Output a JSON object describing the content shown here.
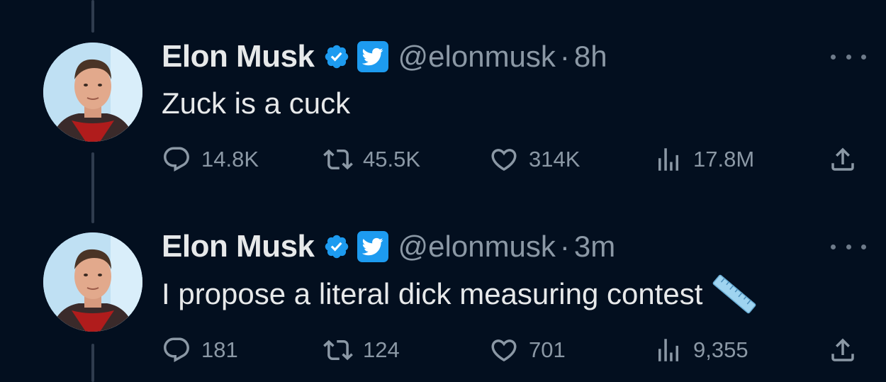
{
  "tweets": [
    {
      "name": "Elon Musk",
      "handle": "@elonmusk",
      "separator": "·",
      "time": "8h",
      "text": "Zuck is a cuck",
      "reply_count": "14.8K",
      "retweet_count": "45.5K",
      "like_count": "314K",
      "view_count": "17.8M"
    },
    {
      "name": "Elon Musk",
      "handle": "@elonmusk",
      "separator": "·",
      "time": "3m",
      "text": "I propose a literal dick measuring contest",
      "reply_count": "181",
      "retweet_count": "124",
      "like_count": "701",
      "view_count": "9,355"
    }
  ],
  "colors": {
    "background": "#030f1f",
    "text": "#e7e9ea",
    "muted": "#8b98a5",
    "accent": "#1d9bf0"
  },
  "icons": [
    "verified-badge-icon",
    "twitter-bird-icon",
    "more-icon",
    "reply-icon",
    "retweet-icon",
    "like-icon",
    "views-icon",
    "share-icon",
    "ruler-emoji-icon"
  ]
}
